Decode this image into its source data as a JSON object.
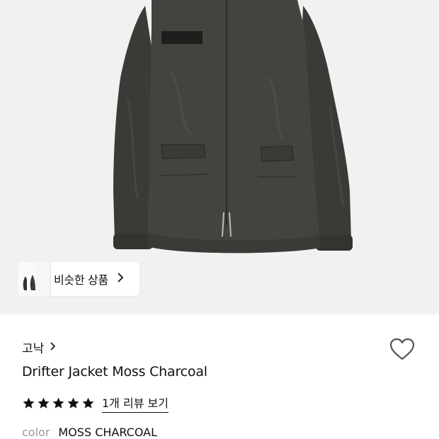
{
  "product": {
    "similar_label": "비슷한 상품",
    "brand": "고낙",
    "title": "Drifter Jacket Moss Charcoal",
    "rating": 5,
    "review_link": "1개 리뷰 보기",
    "color_label": "color",
    "color_value": "MOSS CHARCOAL"
  },
  "icons": {
    "similar_arrow": "chevron-right-icon",
    "brand_arrow": "chevron-right-icon",
    "like": "heart-outline-icon",
    "star": "star-filled-icon"
  },
  "colors": {
    "hero_background": "#f1f1f1",
    "jacket": "#3e3f3b",
    "text": "#111111",
    "muted": "#999999"
  }
}
